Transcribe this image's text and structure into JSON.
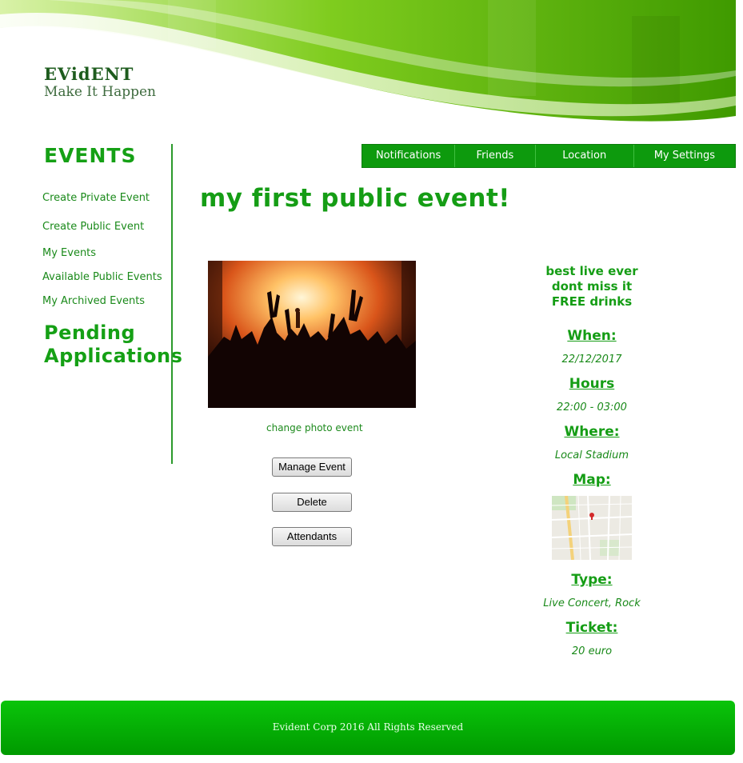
{
  "brand": {
    "name": "EVidENT",
    "tagline": "Make It Happen"
  },
  "nav": {
    "items": [
      "Notifications",
      "Friends",
      "Location",
      "My Settings"
    ]
  },
  "sidebar": {
    "title": "EVENTS",
    "links": [
      "Create Private Event",
      "Create Public Event",
      "My Events",
      "Available Public Events",
      "My Archived Events"
    ],
    "pending_line1": "Pending",
    "pending_line2": "Applications"
  },
  "event": {
    "title": "my first public event!",
    "change_photo": "change photo event",
    "buttons": {
      "manage": "Manage Event",
      "delete": "Delete",
      "attendants": "Attendants"
    },
    "description": [
      "best live ever",
      "dont miss it",
      "FREE drinks"
    ],
    "when_label": "When:",
    "when_value": "22/12/2017",
    "hours_label": "Hours",
    "hours_value": "22:00 - 03:00",
    "where_label": "Where:",
    "where_value": "Local Stadium",
    "map_label": "Map:",
    "type_label": "Type:",
    "type_value": "Live Concert, Rock",
    "ticket_label": "Ticket:",
    "ticket_value": "20 euro"
  },
  "footer": {
    "text": "Evident Corp  2016 All Rights Reserved"
  },
  "colors": {
    "accent": "#159d15",
    "nav_bg": "#0d9a0d",
    "footer_bg": "#00b000"
  },
  "icons": {
    "photo": "concert-crowd-image",
    "map": "street-map-image"
  }
}
